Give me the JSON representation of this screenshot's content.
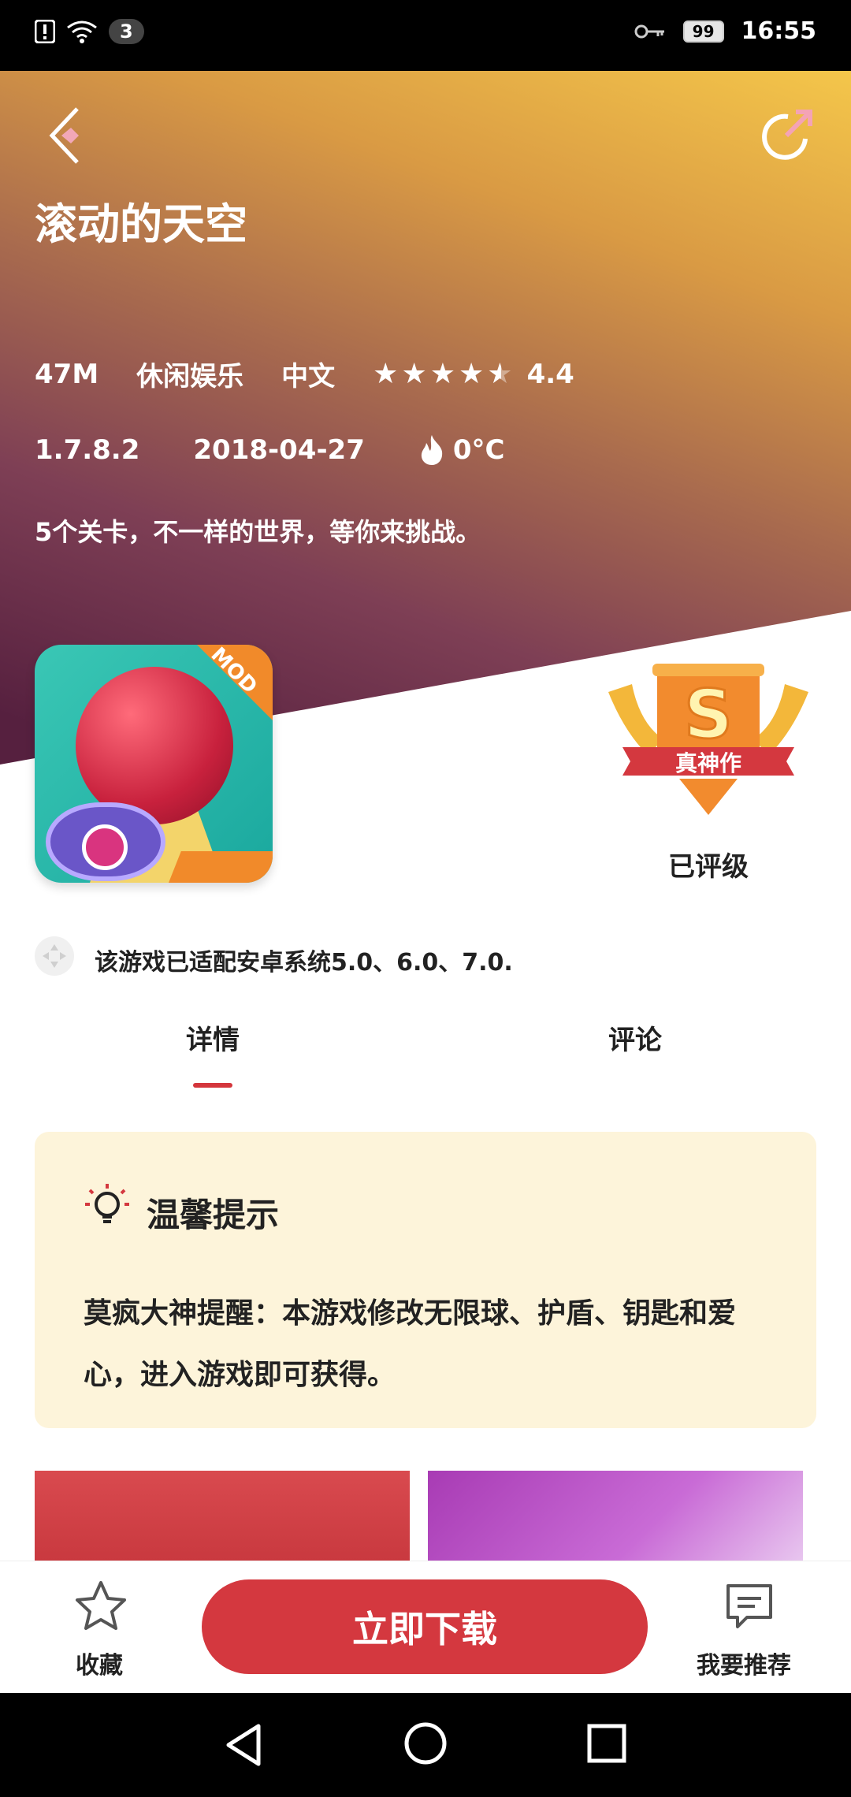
{
  "status_bar": {
    "notification_count": "3",
    "battery": "99",
    "time": "16:55"
  },
  "header": {
    "title": "滚动的天空",
    "size": "47M",
    "category": "休闲娱乐",
    "language": "中文",
    "rating": "4.4",
    "rating_value": 4.4,
    "version": "1.7.8.2",
    "date": "2018-04-27",
    "temperature": "0°C",
    "description": "5个关卡，不一样的世界，等你来挑战。"
  },
  "app_icon": {
    "badge": "MOD"
  },
  "award": {
    "grade": "S",
    "ribbon": "真神作",
    "label": "已评级"
  },
  "compat": {
    "text": "该游戏已适配安卓系统5.0、6.0、7.0."
  },
  "tabs": [
    {
      "label": "详情",
      "active": true
    },
    {
      "label": "评论",
      "active": false
    }
  ],
  "tip": {
    "title": "温馨提示",
    "body": "莫疯大神提醒：本游戏修改无限球、护盾、钥匙和爱心，进入游戏即可获得。"
  },
  "bottom": {
    "favorite": "收藏",
    "download": "立即下载",
    "recommend": "我要推荐"
  },
  "icons": [
    "back-icon",
    "share-icon",
    "star-icon",
    "fire-icon",
    "gamepad-icon",
    "lightbulb-icon",
    "favorite-star-icon",
    "recommend-chat-icon",
    "nav-back-icon",
    "nav-home-icon",
    "nav-recents-icon"
  ],
  "colors": {
    "accent": "#d4383f",
    "tip_bg": "#fdf4da"
  }
}
